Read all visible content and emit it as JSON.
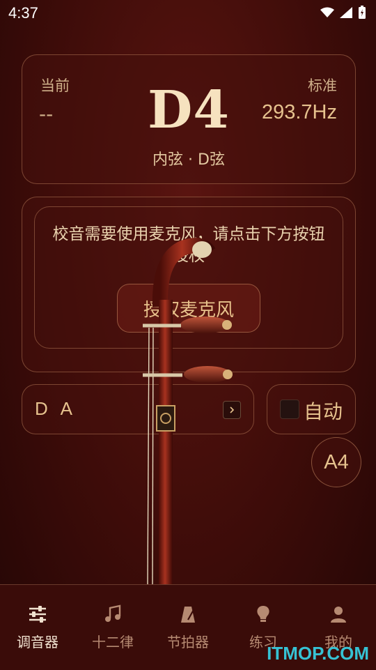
{
  "status_bar": {
    "time": "4:37"
  },
  "pitch_card": {
    "current_label": "当前",
    "current_value": "--",
    "note": "D4",
    "standard_label": "标准",
    "standard_value": "293.7Hz",
    "string_name": "内弦 · D弦"
  },
  "mic_card": {
    "message": "校音需要使用麦克风，请点击下方按钮授权",
    "button_label": "授权麦克风"
  },
  "controls": {
    "string_set": "D A",
    "auto_label": "自动",
    "reference_label": "A4"
  },
  "nav": {
    "items": [
      {
        "label": "调音器",
        "icon": "tuner-sliders-icon",
        "active": true
      },
      {
        "label": "十二律",
        "icon": "music-note-icon",
        "active": false
      },
      {
        "label": "节拍器",
        "icon": "metronome-icon",
        "active": false
      },
      {
        "label": "练习",
        "icon": "lightbulb-icon",
        "active": false
      },
      {
        "label": "我的",
        "icon": "user-icon",
        "active": false
      }
    ]
  },
  "watermark": "ITMOP.COM"
}
